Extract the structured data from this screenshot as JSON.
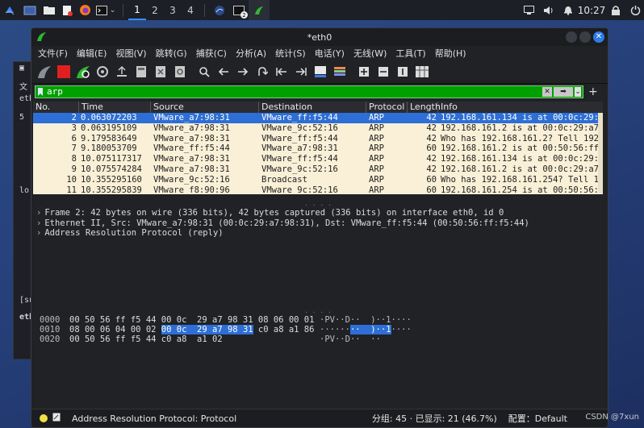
{
  "taskbar": {
    "workspaces": [
      "1",
      "2",
      "3",
      "4"
    ],
    "active_workspace": "1",
    "clock": "10:27",
    "notification_badge": "2"
  },
  "bg_terminal": {
    "lines": [
      "文",
      "eth",
      "5",
      "lo:",
      "[su",
      "eth"
    ]
  },
  "window": {
    "title": "*eth0",
    "menu": [
      "文件(F)",
      "编辑(E)",
      "视图(V)",
      "跳转(G)",
      "捕获(C)",
      "分析(A)",
      "统计(S)",
      "电话(Y)",
      "无线(W)",
      "工具(T)",
      "帮助(H)"
    ]
  },
  "filter": {
    "value": "arp"
  },
  "packet_list": {
    "columns": [
      "No.",
      "Time",
      "Source",
      "Destination",
      "Protocol",
      "Length",
      "Info"
    ],
    "rows": [
      [
        "2",
        "0.063072203",
        "VMware_a7:98:31",
        "VMware_ff:f5:44",
        "ARP",
        "42",
        "192.168.161.134 is at 00:0c:29:"
      ],
      [
        "3",
        "0.063195109",
        "VMware_a7:98:31",
        "VMware_9c:52:16",
        "ARP",
        "42",
        "192.168.161.2 is at 00:0c:29:a7"
      ],
      [
        "6",
        "9.179583649",
        "VMware_a7:98:31",
        "VMware_ff:f5:44",
        "ARP",
        "42",
        "Who has 192.168.161.2? Tell 192"
      ],
      [
        "7",
        "9.180053709",
        "VMware_ff:f5:44",
        "VMware_a7:98:31",
        "ARP",
        "60",
        "192.168.161.2 is at 00:50:56:ff"
      ],
      [
        "8",
        "10.075117317",
        "VMware_a7:98:31",
        "VMware_ff:f5:44",
        "ARP",
        "42",
        "192.168.161.134 is at 00:0c:29:"
      ],
      [
        "9",
        "10.075574284",
        "VMware_a7:98:31",
        "VMware_9c:52:16",
        "ARP",
        "42",
        "192.168.161.2 is at 00:0c:29:a7"
      ],
      [
        "10",
        "10.355295160",
        "VMware_9c:52:16",
        "Broadcast",
        "ARP",
        "60",
        "Who has 192.168.161.254? Tell 1"
      ],
      [
        "11",
        "10.355295839",
        "VMware_f8:90:96",
        "VMware_9c:52:16",
        "ARP",
        "60",
        "192.168.161.254 is at 00:50:56:"
      ]
    ],
    "selected_index": 0
  },
  "details": [
    "Frame 2: 42 bytes on wire (336 bits), 42 bytes captured (336 bits) on interface eth0, id 0",
    "Ethernet II, Src: VMware_a7:98:31 (00:0c:29:a7:98:31), Dst: VMware_ff:f5:44 (00:50:56:ff:f5:44)",
    "Address Resolution Protocol (reply)"
  ],
  "bytes": [
    {
      "offset": "0000",
      "pre": "00 50 56 ff f5 44 00 0c  29 a7 98 31 08 06 00 01",
      "hl": "",
      "post": "",
      "ascii_pre": "·PV··D··  )··1····",
      "ascii_hl": "",
      "ascii_post": ""
    },
    {
      "offset": "0010",
      "pre": "08 00 06 04 00 02 ",
      "hl": "00 0c  29 a7 98 31",
      "post": " c0 a8 a1 86",
      "ascii_pre": "······",
      "ascii_hl": "··  )··1",
      "ascii_post": "····"
    },
    {
      "offset": "0020",
      "pre": "00 50 56 ff f5 44 c0 a8  a1 02",
      "hl": "",
      "post": "",
      "ascii_pre": "·PV··D··  ··",
      "ascii_hl": "",
      "ascii_post": ""
    }
  ],
  "status": {
    "text": "Address Resolution Protocol: Protocol",
    "packets": "分组: 45 · 已显示: 21 (46.7%)",
    "profile": "配置：Default"
  },
  "watermark": "CSDN @7xun",
  "colors": {
    "filter_ok": "#00a000",
    "selection": "#2d6fd6",
    "arp_row": "#faf0d7"
  }
}
